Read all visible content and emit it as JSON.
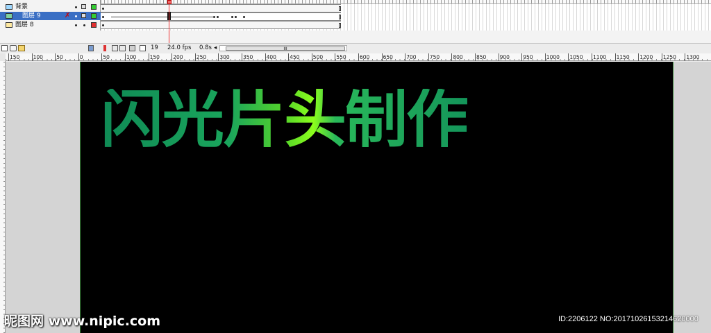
{
  "timeline": {
    "layers": [
      {
        "name": "背景",
        "color": "#33cc33",
        "selected": false
      },
      {
        "name": "图层 9",
        "color": "#33cc33",
        "selected": true
      },
      {
        "name": "图层 8",
        "color": "#e03030",
        "selected": false
      }
    ],
    "current_frame": "19",
    "frame_rate": "24.0 fps",
    "elapsed_time": "0.8s",
    "scroll_thumb_label": "III"
  },
  "ruler": {
    "labels": [
      "150",
      "100",
      "50",
      "0",
      "50",
      "100",
      "150",
      "200",
      "250",
      "300",
      "350",
      "400",
      "450",
      "500",
      "550",
      "600",
      "650",
      "700",
      "750",
      "800",
      "850",
      "900",
      "950",
      "1000",
      "1050",
      "1100",
      "1150",
      "1200",
      "1250",
      "1300"
    ]
  },
  "stage": {
    "headline": "闪光片头制作",
    "background": "#000000",
    "text_gradient": [
      "#0f8a55",
      "#8cff1c"
    ]
  },
  "watermark": {
    "logo": "昵图网 www.nipic.com",
    "id_text": "ID:2206122 NO:20171026153214620000"
  }
}
